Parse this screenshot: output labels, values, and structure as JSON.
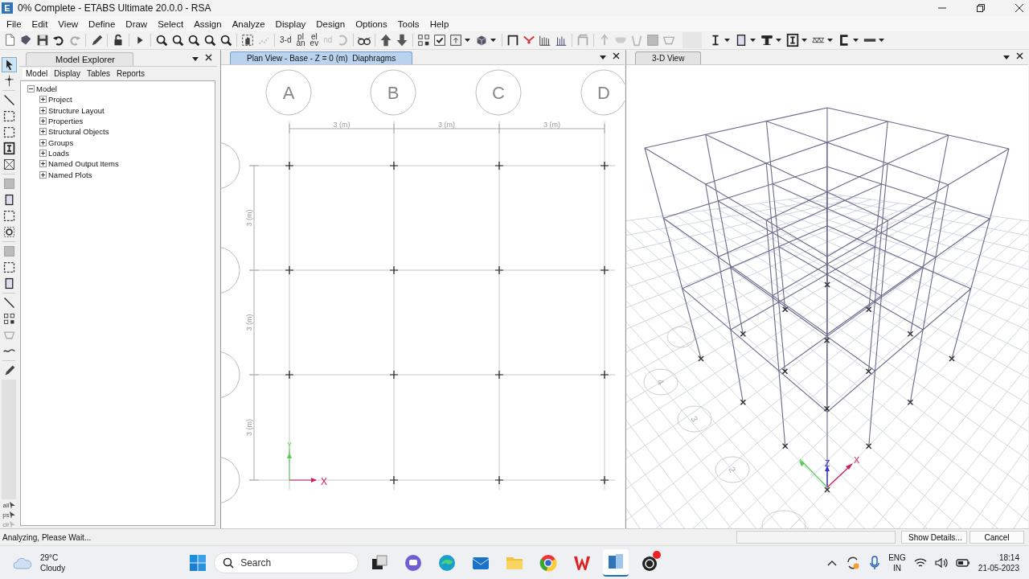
{
  "window": {
    "title": "0% Complete - ETABS Ultimate 20.0.0 - RSA",
    "app_letter": "E"
  },
  "menu": [
    "File",
    "Edit",
    "View",
    "Define",
    "Draw",
    "Select",
    "Assign",
    "Analyze",
    "Display",
    "Design",
    "Options",
    "Tools",
    "Help"
  ],
  "toolbar": {
    "text_buttons": [
      {
        "lines": [
          "3-d"
        ],
        "disabled": false
      },
      {
        "lines": [
          "pl",
          "an"
        ],
        "disabled": false
      },
      {
        "lines": [
          "el",
          "ev"
        ],
        "disabled": false
      },
      {
        "lines": [
          "nd"
        ],
        "disabled": true
      }
    ]
  },
  "side_toolbar": {
    "labels": [
      {
        "text": "all",
        "disabled": false
      },
      {
        "text": "ps",
        "disabled": false
      },
      {
        "text": "clr",
        "disabled": true
      }
    ]
  },
  "model_explorer": {
    "title": "Model Explorer",
    "tabs": [
      {
        "label": "Model",
        "selected": true
      },
      {
        "label": "Display",
        "selected": false
      },
      {
        "label": "Tables",
        "selected": false
      },
      {
        "label": "Reports",
        "selected": false
      }
    ],
    "tree": [
      {
        "label": "Model",
        "expanded": true,
        "children": [
          {
            "label": "Project",
            "expanded": false
          },
          {
            "label": "Structure Layout",
            "expanded": false
          },
          {
            "label": "Properties",
            "expanded": false
          },
          {
            "label": "Structural Objects",
            "expanded": false
          },
          {
            "label": "Groups",
            "expanded": false
          },
          {
            "label": "Loads",
            "expanded": false
          },
          {
            "label": "Named Output Items",
            "expanded": false
          },
          {
            "label": "Named Plots",
            "expanded": false
          }
        ]
      }
    ]
  },
  "plan_view": {
    "tab": {
      "label": "Plan View - Base - Z = 0 (m)  Diaphragms",
      "selected": true
    },
    "grid_columns": [
      "A",
      "B",
      "C",
      "D"
    ],
    "x_spacings": [
      "3 (m)",
      "3 (m)",
      "3 (m)"
    ],
    "y_spacings": [
      "3 (m)",
      "3 (m)",
      "3 (m)"
    ],
    "axes": {
      "x": "X",
      "y": "Y"
    }
  },
  "view_3d": {
    "tab": {
      "label": "3-D View",
      "selected": false
    },
    "grid_bubbles": [
      "4",
      "3",
      "2"
    ],
    "axes": {
      "x": "X",
      "z": "Z"
    }
  },
  "status_bar": {
    "message": "Analyzing, Please Wait...",
    "progress": {
      "level": 0
    },
    "buttons": [
      "Show Details...",
      "Cancel"
    ]
  },
  "taskbar": {
    "weather": {
      "temperature": "29°C",
      "condition": "Cloudy"
    },
    "search": {
      "label": "Search"
    },
    "apps": [
      {
        "kind": "task-view",
        "active": false,
        "notification": false
      },
      {
        "kind": "chat",
        "active": false,
        "notification": false
      },
      {
        "kind": "edge",
        "active": false,
        "notification": false
      },
      {
        "kind": "mail",
        "active": false,
        "notification": false
      },
      {
        "kind": "folder",
        "active": false,
        "notification": false
      },
      {
        "kind": "chrome",
        "active": false,
        "notification": false
      },
      {
        "kind": "wps",
        "active": false,
        "notification": false
      },
      {
        "kind": "etabs",
        "active": true,
        "notification": false
      },
      {
        "kind": "obs",
        "active": false,
        "notification": true
      }
    ],
    "language": [
      "ENG",
      "IN"
    ],
    "time": "18:14",
    "date": "21-05-2023"
  }
}
